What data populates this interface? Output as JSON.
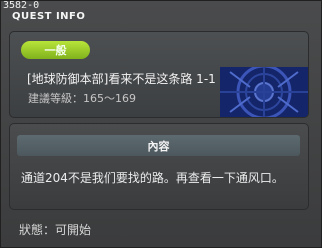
{
  "window": {
    "id_text": "3582-0",
    "title": "QUEST INFO"
  },
  "quest": {
    "category": "一般",
    "name": "[地球防御本部]看来不是这条路 1-1",
    "level": "建議等級：165～169"
  },
  "content": {
    "header": "內容",
    "text": "通道204不是我们要找的路。再查看一下通风口。"
  },
  "status": "狀態：可開始",
  "colors": {
    "badge": "#9ccc2c",
    "deco": "#1a2d78",
    "background": "#3f4041"
  }
}
